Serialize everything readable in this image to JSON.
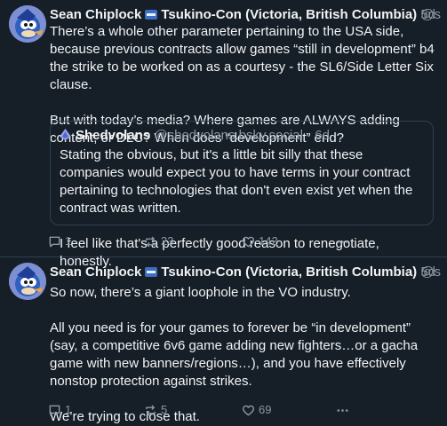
{
  "posts": [
    {
      "author": "Sean Chiplock",
      "badge_icon": "flag-badge-icon",
      "location": "Tsukino-Con (Victoria, British Columbia)",
      "handle": "@soni…",
      "separator": "·",
      "age": "5d",
      "paragraphs": [
        "There’s a whole other parameter pertaining to the USA side, because previous contracts allow games “still in development” b4 the strike to be worked on as a courtesy - the SL6/Side Letter Six clause.",
        "But with today’s media? Where games are ALWAYS adding content, or DLC? When does “development” end?"
      ],
      "quote": {
        "author": "Shedvolans",
        "handle": "@shedvolans.bsky.social",
        "separator": "·",
        "age": "6d",
        "paragraphs": [
          "Stating the obvious, but it's a little bit silly that these companies would expect you to have terms in your contract pertaining to technologies that don't even exist yet when the contract was written.",
          "I feel like that's a perfectly good reason to renegotiate, honestly."
        ]
      },
      "actions": {
        "replies": "1",
        "reposts": "23",
        "likes": "142"
      }
    },
    {
      "author": "Sean Chiplock",
      "badge_icon": "flag-badge-icon",
      "location": "Tsukino-Con (Victoria, British Columbia)",
      "handle": "@soni…",
      "separator": "·",
      "age": "5d",
      "paragraphs": [
        "So now, there’s a giant loophole in the VO industry.",
        "All you need is for your games to forever be “in development” (say, a competitive 6v6 game adding new fighters…or a gacha game with new banners/regions…), and you have effectively nonstop protection against strikes.",
        "We’re trying to close that."
      ],
      "actions": {
        "replies": "1",
        "reposts": "5",
        "likes": "69"
      }
    }
  ],
  "colors": {
    "background": "#161e27",
    "text": "#f1f3f5",
    "muted": "#8b98a5",
    "border": "#2e4052"
  }
}
